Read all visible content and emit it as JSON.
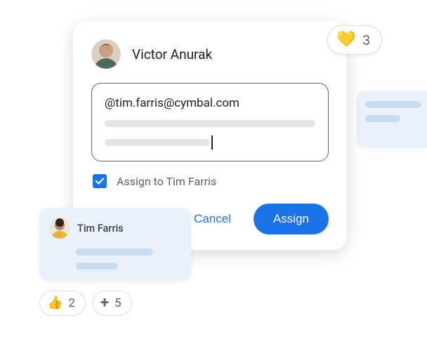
{
  "dialog": {
    "author_name": "Victor Anurak",
    "mention_text": "@tim.farris@cymbal.com",
    "assign_label": "Assign to Tim Farris",
    "assign_checked": true,
    "cancel_label": "Cancel",
    "assign_button_label": "Assign"
  },
  "reactions": {
    "heart_count": "3",
    "thumbs_count": "2",
    "plus_count": "5"
  },
  "suggestion_card": {
    "name": "Tim Farris"
  }
}
